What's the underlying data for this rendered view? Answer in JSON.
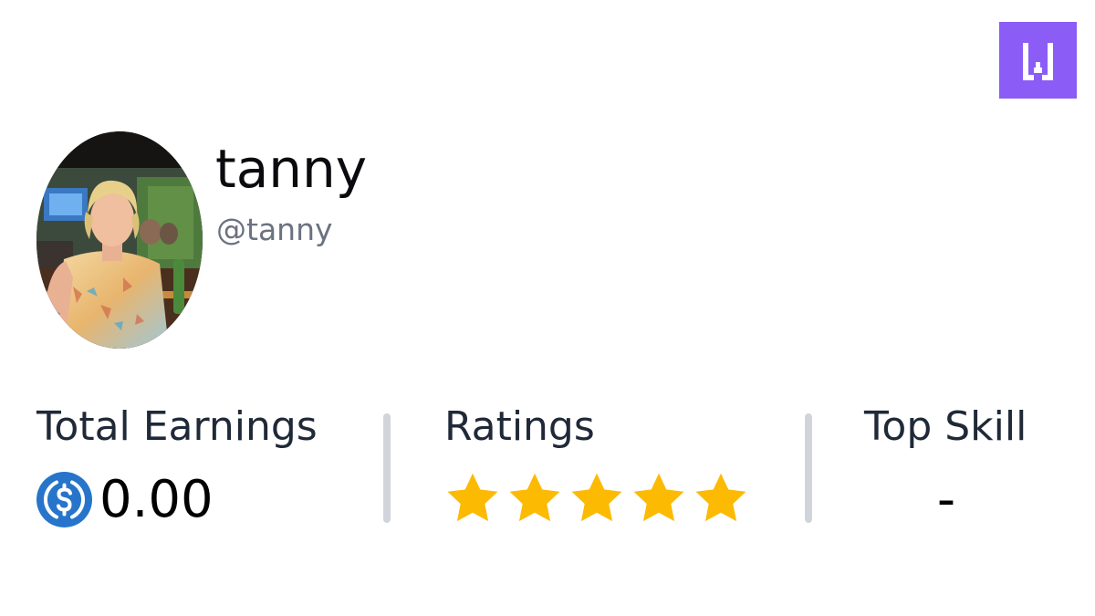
{
  "profile": {
    "display_name": "tanny",
    "handle": "@tanny",
    "avatar_icon": "user-avatar-photo"
  },
  "brand": {
    "logo_icon": "w-logo-icon",
    "color": "#8b5cf6"
  },
  "stats": {
    "earnings": {
      "label": "Total Earnings",
      "currency_icon": "usdc-coin-icon",
      "currency_color": "#2775ca",
      "value": "0.00"
    },
    "ratings": {
      "label": "Ratings",
      "stars_filled": 5,
      "stars_total": 5,
      "star_color": "#fcba03"
    },
    "top_skill": {
      "label": "Top Skill",
      "value": "-"
    }
  }
}
